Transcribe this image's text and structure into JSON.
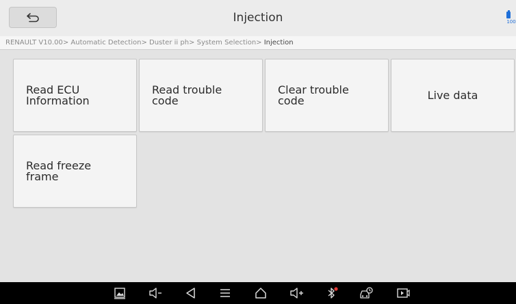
{
  "header": {
    "title": "Injection",
    "back_icon": "back-arrow-icon",
    "battery": {
      "icon": "battery-icon",
      "label": "100",
      "color": "#1e6fd9"
    }
  },
  "breadcrumb": {
    "path": "RENAULT V10.00> Automatic Detection> Duster ii ph> System Selection> ",
    "current": "Injection"
  },
  "tiles": [
    {
      "label": "Read ECU\nInformation"
    },
    {
      "label": "Read trouble\ncode"
    },
    {
      "label": "Clear trouble\ncode"
    },
    {
      "label": "Live data"
    },
    {
      "label": "Read freeze\nframe"
    }
  ],
  "navbar": {
    "icons": [
      "screenshot-icon",
      "volume-down-icon",
      "back-icon",
      "menu-icon",
      "home-icon",
      "volume-up-icon",
      "bluetooth-icon",
      "car-diagnostic-icon",
      "screen-record-icon"
    ],
    "notification_color": "#e53935"
  }
}
